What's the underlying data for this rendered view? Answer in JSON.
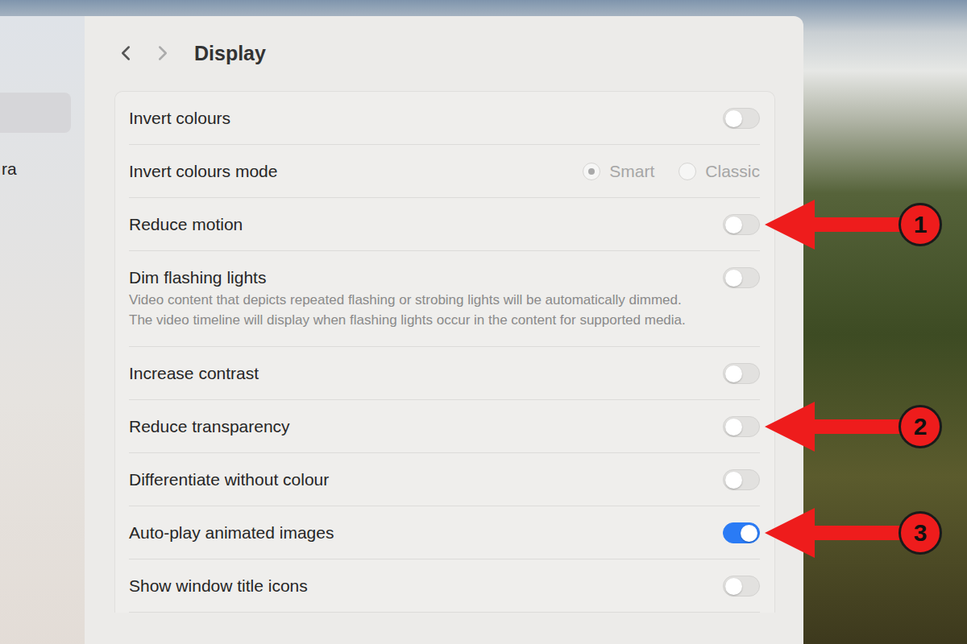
{
  "window": {
    "title": "Display"
  },
  "navigation": {
    "back_enabled": true,
    "forward_enabled": false
  },
  "sidebar": {
    "items": [
      {
        "label": "",
        "selected": true
      },
      {
        "label": "ra",
        "selected": false
      }
    ]
  },
  "settings": [
    {
      "kind": "toggle",
      "label": "Invert colours",
      "on": false,
      "description": ""
    },
    {
      "kind": "radio",
      "label": "Invert colours mode",
      "disabled": true,
      "options": [
        {
          "label": "Smart",
          "selected": true
        },
        {
          "label": "Classic",
          "selected": false
        }
      ]
    },
    {
      "kind": "toggle",
      "label": "Reduce motion",
      "on": false,
      "description": ""
    },
    {
      "kind": "toggle",
      "label": "Dim flashing lights",
      "on": false,
      "description": "Video content that depicts repeated flashing or strobing lights will be automatically dimmed. The video timeline will display when flashing lights occur in the content for supported media."
    },
    {
      "kind": "toggle",
      "label": "Increase contrast",
      "on": false,
      "description": ""
    },
    {
      "kind": "toggle",
      "label": "Reduce transparency",
      "on": false,
      "description": ""
    },
    {
      "kind": "toggle",
      "label": "Differentiate without colour",
      "on": false,
      "description": ""
    },
    {
      "kind": "toggle",
      "label": "Auto-play animated images",
      "on": true,
      "description": ""
    },
    {
      "kind": "toggle",
      "label": "Show window title icons",
      "on": false,
      "description": ""
    }
  ],
  "annotations": [
    {
      "number": "1",
      "target": "Reduce motion"
    },
    {
      "number": "2",
      "target": "Reduce transparency"
    },
    {
      "number": "3",
      "target": "Auto-play animated images"
    }
  ]
}
